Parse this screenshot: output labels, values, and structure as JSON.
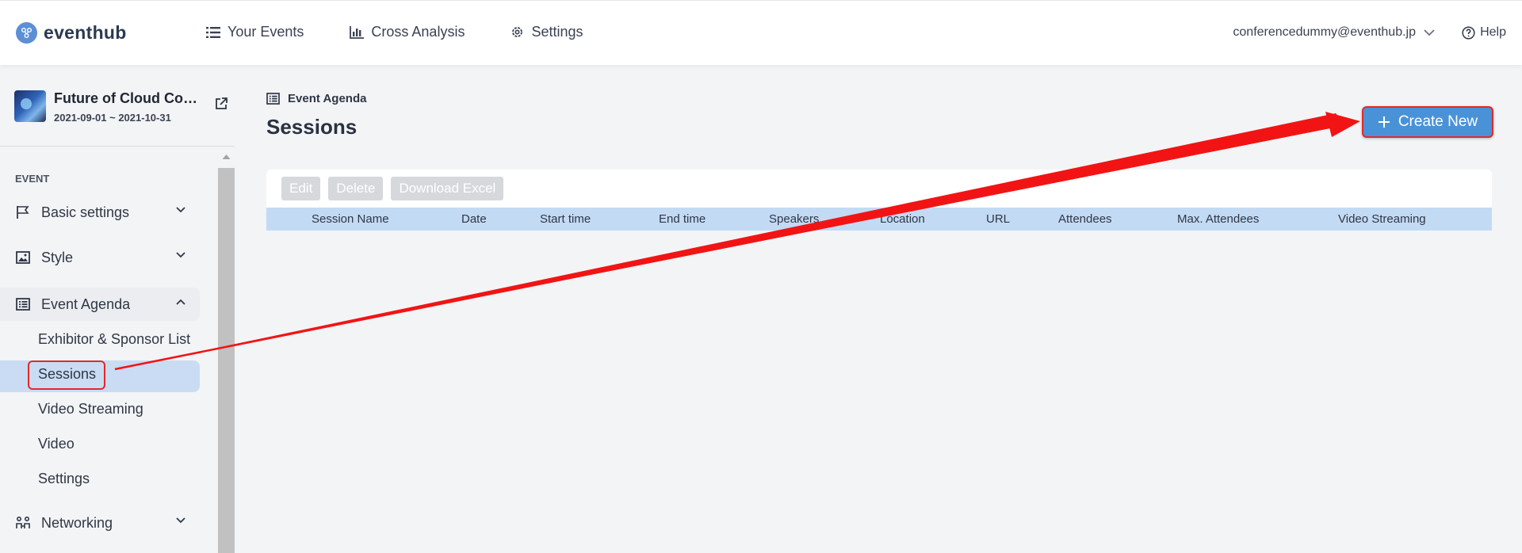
{
  "app": {
    "name": "eventhub"
  },
  "nav": {
    "items": [
      {
        "label": "Your Events",
        "icon": "list-icon"
      },
      {
        "label": "Cross Analysis",
        "icon": "bar-chart-icon"
      },
      {
        "label": "Settings",
        "icon": "gear-icon"
      }
    ]
  },
  "account": {
    "email": "conferencedummy@eventhub.jp",
    "help_label": "Help"
  },
  "event": {
    "title": "Future of Cloud Co…",
    "dates": "2021-09-01 ~ 2021-10-31"
  },
  "sidebar": {
    "section_label": "EVENT",
    "items": [
      {
        "label": "Basic settings",
        "icon": "flag-icon"
      },
      {
        "label": "Style",
        "icon": "image-icon"
      },
      {
        "label": "Event Agenda",
        "icon": "agenda-icon"
      },
      {
        "label": "Networking",
        "icon": "networking-icon"
      }
    ],
    "sub_items": [
      {
        "label": "Exhibitor & Sponsor List"
      },
      {
        "label": "Sessions",
        "active": true
      },
      {
        "label": "Video Streaming"
      },
      {
        "label": "Video"
      },
      {
        "label": "Settings"
      }
    ]
  },
  "main": {
    "breadcrumb": "Event Agenda",
    "title": "Sessions",
    "create_label": "Create New",
    "toolbar": {
      "edit": "Edit",
      "delete": "Delete",
      "download": "Download Excel"
    },
    "columns": [
      "Session Name",
      "Date",
      "Start time",
      "End time",
      "Speakers",
      "Location",
      "URL",
      "Attendees",
      "Max. Attendees",
      "Video Streaming"
    ]
  },
  "colors": {
    "accent": "#4a92d8",
    "highlight": "#e02a2a",
    "table_header": "#c3daf4"
  }
}
